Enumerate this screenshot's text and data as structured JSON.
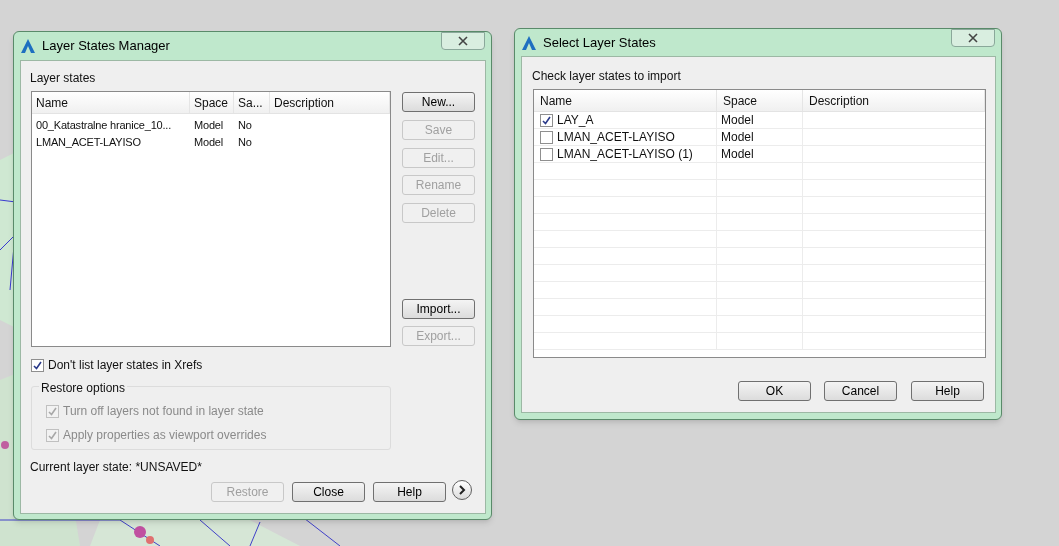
{
  "layer_states_manager": {
    "window": {
      "title": "Layer States Manager"
    },
    "section_label": "Layer states",
    "table": {
      "columns": [
        "Name",
        "Space",
        "Sa...",
        "Description"
      ],
      "rows": [
        {
          "cells": [
            "00_Katastralne hranice_10...",
            "Model",
            "No",
            ""
          ]
        },
        {
          "cells": [
            "LMAN_ACET-LAYISO",
            "Model",
            "No",
            ""
          ]
        }
      ]
    },
    "side_buttons": [
      {
        "label": "New...",
        "disabled": false
      },
      {
        "label": "Save",
        "disabled": true
      },
      {
        "label": "Edit...",
        "disabled": true
      },
      {
        "label": "Rename",
        "disabled": true
      },
      {
        "label": "Delete",
        "disabled": true
      },
      {
        "label": "Import...",
        "disabled": false
      },
      {
        "label": "Export...",
        "disabled": true
      }
    ],
    "xref_option": {
      "label": "Don't list layer states in Xrefs",
      "checked": true
    },
    "restore_options": {
      "title": "Restore options",
      "options": [
        {
          "label": "Turn off layers not found in layer state",
          "checked": true,
          "disabled": true
        },
        {
          "label": "Apply properties as viewport overrides",
          "checked": true,
          "disabled": true
        }
      ]
    },
    "current_state": "Current layer state: *UNSAVED*",
    "buttons": [
      {
        "label": "Restore",
        "disabled": true
      },
      {
        "label": "Close",
        "disabled": false
      },
      {
        "label": "Help",
        "disabled": false
      }
    ]
  },
  "select_layer_states": {
    "window": {
      "title": "Select Layer States"
    },
    "instruction": "Check layer states to import",
    "table": {
      "columns": [
        "Name",
        "Space",
        "Description"
      ],
      "rows": [
        {
          "name": "LAY_A",
          "space": "Model",
          "checked": true
        },
        {
          "name": "LMAN_ACET-LAYISO",
          "space": "Model",
          "checked": false
        },
        {
          "name": "LMAN_ACET-LAYISO (1)",
          "space": "Model",
          "checked": false
        }
      ]
    },
    "buttons": [
      {
        "label": "OK"
      },
      {
        "label": "Cancel"
      },
      {
        "label": "Help"
      }
    ]
  }
}
